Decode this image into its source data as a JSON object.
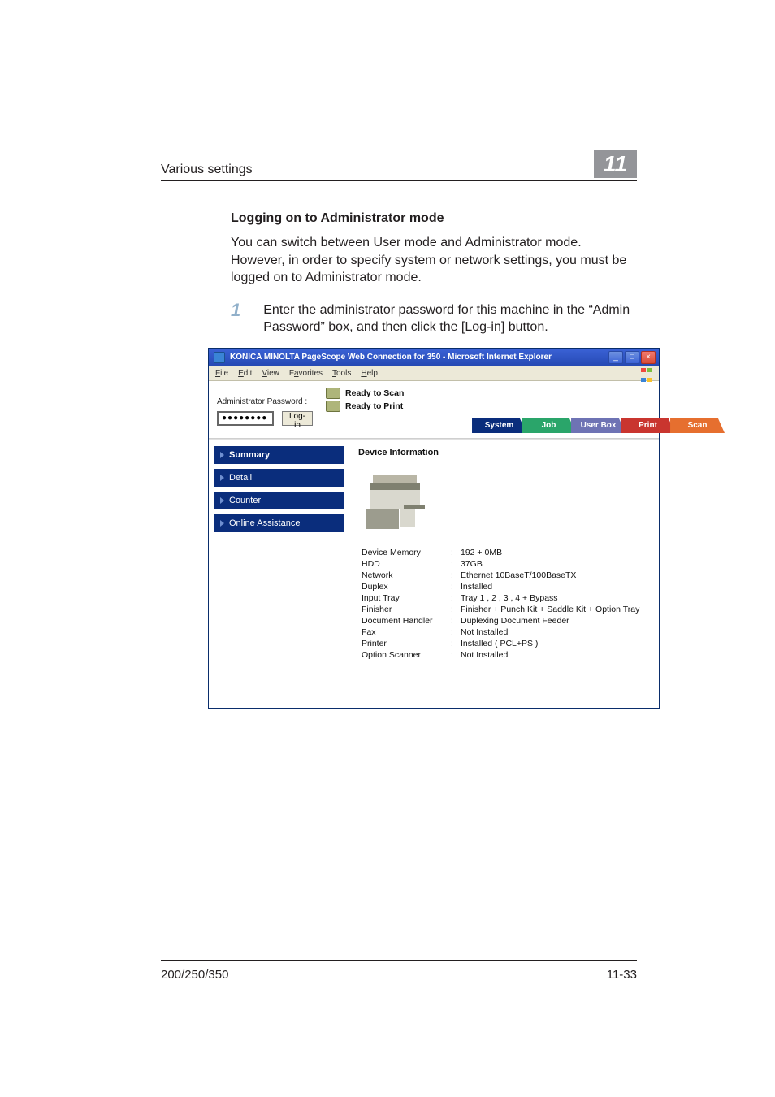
{
  "header": {
    "title": "Various settings",
    "chapter": "11"
  },
  "section": {
    "heading": "Logging on to Administrator mode",
    "paragraph": "You can switch between User mode and Administrator mode. However, in order to specify system or network settings, you must be logged on to Administrator mode."
  },
  "step1": {
    "num": "1",
    "text": "Enter the administrator password for this machine in the “Admin Password” box, and then click the [Log-in] button."
  },
  "browser": {
    "title": "KONICA MINOLTA PageScope Web Connection for 350 - Microsoft Internet Explorer",
    "menus": [
      "File",
      "Edit",
      "View",
      "Favorites",
      "Tools",
      "Help"
    ]
  },
  "ready": {
    "scan": "Ready to Scan",
    "print": "Ready to Print"
  },
  "login": {
    "label": "Administrator Password :",
    "value": "●●●●●●●●",
    "button": "Log-in"
  },
  "tabs": {
    "system": "System",
    "job": "Job",
    "userbox": "User Box",
    "print": "Print",
    "scan": "Scan"
  },
  "sidebar": [
    "Summary",
    "Detail",
    "Counter",
    "Online Assistance"
  ],
  "device": {
    "title": "Device Information",
    "rows": [
      {
        "k": "Device Memory",
        "v": "192 + 0MB"
      },
      {
        "k": "HDD",
        "v": "37GB"
      },
      {
        "k": "Network",
        "v": "Ethernet 10BaseT/100BaseTX"
      },
      {
        "k": "Duplex",
        "v": "Installed"
      },
      {
        "k": "Input Tray",
        "v": "Tray 1 , 2 , 3 , 4 + Bypass"
      },
      {
        "k": "Finisher",
        "v": "Finisher + Punch Kit + Saddle Kit + Option Tray"
      },
      {
        "k": "Document Handler",
        "v": "Duplexing Document Feeder"
      },
      {
        "k": "Fax",
        "v": "Not Installed"
      },
      {
        "k": "Printer",
        "v": "Installed ( PCL+PS )"
      },
      {
        "k": "Option Scanner",
        "v": "Not Installed"
      }
    ]
  },
  "footer": {
    "left": "200/250/350",
    "right": "11-33"
  }
}
